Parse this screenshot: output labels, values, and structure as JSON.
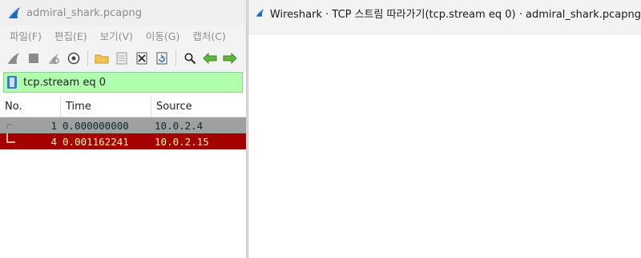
{
  "main_window": {
    "title": "admiral_shark.pcapng",
    "menu": [
      "파일(F)",
      "편집(E)",
      "보기(V)",
      "이동(G)",
      "캡처(C)"
    ],
    "toolbar_icons": [
      "shark-fin-start-icon",
      "stop-icon",
      "restart-icon",
      "options-gear-icon",
      "open-folder-icon",
      "save-file-icon",
      "close-file-icon",
      "reload-icon",
      "find-icon",
      "back-arrow-icon",
      "forward-arrow-icon"
    ],
    "filter": {
      "value": "tcp.stream eq 0",
      "background": "#afffaf"
    },
    "packet_list": {
      "columns": [
        "No.",
        "Time",
        "Source"
      ],
      "rows": [
        {
          "no": "1",
          "time": "0.000000000",
          "source": "10.0.2.4",
          "bg": "#a0a0a0",
          "fg": "#12272e"
        },
        {
          "no": "4",
          "time": "0.001162241",
          "source": "10.0.2.15",
          "bg": "#a40000",
          "fg": "#fffc9c"
        }
      ]
    }
  },
  "follow_window": {
    "title": "Wireshark · TCP 스트림 따라가기(tcp.stream eq 0) · admiral_shark.pcapng"
  },
  "colors": {
    "accent_blue": "#2a62c9",
    "filter_green": "#afffaf"
  }
}
